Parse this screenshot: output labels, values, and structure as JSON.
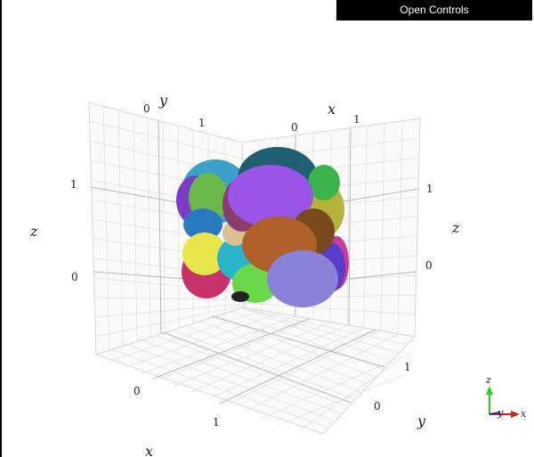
{
  "controls": {
    "label": "Open Controls"
  },
  "axes": {
    "back_left_top_label": "y",
    "back_right_top_label": "x",
    "left_label": "z",
    "right_label": "z",
    "bottom_right_label": "y",
    "bottom_left_label": "x",
    "ticks": {
      "y_top_0": "0",
      "y_top_1": "1",
      "x_top_0": "0",
      "x_top_1": "1",
      "z_left_1": "1",
      "z_left_0": "0",
      "z_right_1": "1",
      "z_right_0": "0",
      "x_bottom_0": "0",
      "x_bottom_1": "1",
      "y_bottom_1": "1",
      "y_bottom_0": "0"
    }
  },
  "orientation_gizmo": {
    "z": "z",
    "y": "y",
    "x": "x"
  },
  "cells": [
    {
      "color": "#3aa0c8"
    },
    {
      "color": "#7c3cc8"
    },
    {
      "color": "#6ab84a"
    },
    {
      "color": "#1f5f8a"
    },
    {
      "color": "#b4b43c"
    },
    {
      "color": "#a05f3c"
    },
    {
      "color": "#9a55e8"
    },
    {
      "color": "#b44070"
    },
    {
      "color": "#e8e64a"
    },
    {
      "color": "#c8326a"
    },
    {
      "color": "#3c6ed8"
    },
    {
      "color": "#8080d8"
    },
    {
      "color": "#c85a2a"
    },
    {
      "color": "#2ab4a0"
    },
    {
      "color": "#205060"
    }
  ]
}
